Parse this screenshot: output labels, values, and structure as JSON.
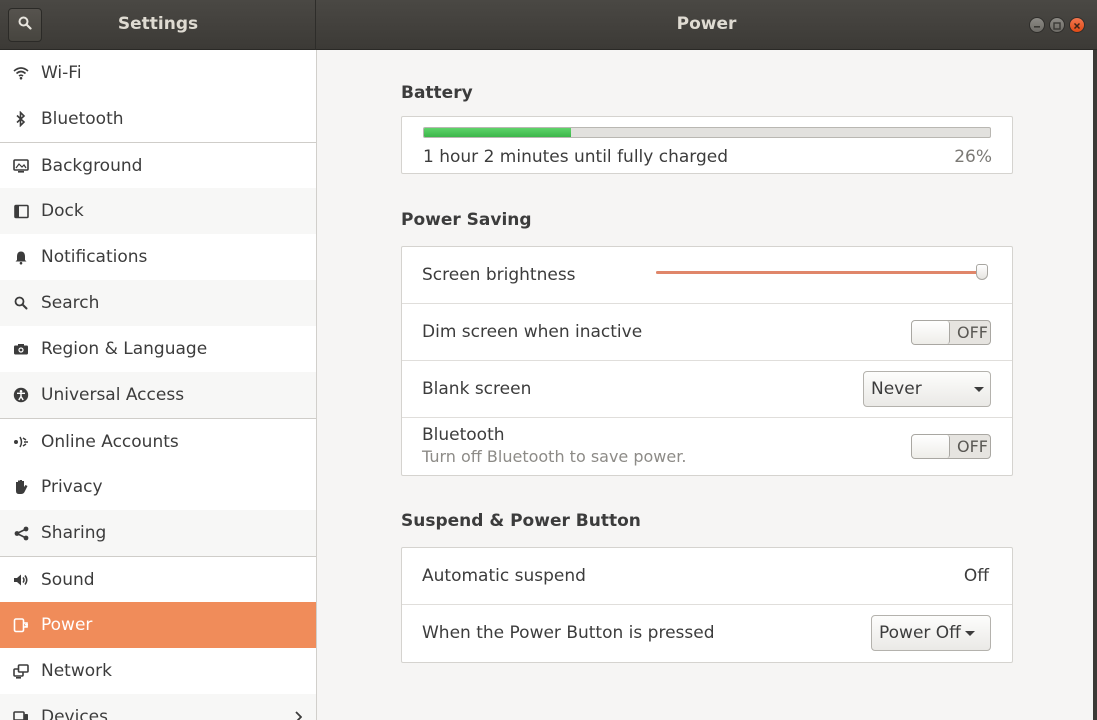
{
  "header": {
    "sidebar_title": "Settings",
    "panel_title": "Power"
  },
  "sidebar": {
    "items": [
      {
        "label": "Wi-Fi",
        "icon": "wifi-icon"
      },
      {
        "label": "Bluetooth",
        "icon": "bluetooth-icon"
      },
      {
        "label": "Background",
        "icon": "background-icon"
      },
      {
        "label": "Dock",
        "icon": "dock-icon"
      },
      {
        "label": "Notifications",
        "icon": "bell-icon"
      },
      {
        "label": "Search",
        "icon": "search-icon"
      },
      {
        "label": "Region & Language",
        "icon": "camera-icon"
      },
      {
        "label": "Universal Access",
        "icon": "accessibility-icon"
      },
      {
        "label": "Online Accounts",
        "icon": "online-accounts-icon"
      },
      {
        "label": "Privacy",
        "icon": "hand-icon"
      },
      {
        "label": "Sharing",
        "icon": "share-icon"
      },
      {
        "label": "Sound",
        "icon": "speaker-icon"
      },
      {
        "label": "Power",
        "icon": "power-icon",
        "active": true
      },
      {
        "label": "Network",
        "icon": "network-icon"
      },
      {
        "label": "Devices",
        "icon": "devices-icon"
      }
    ]
  },
  "battery": {
    "title": "Battery",
    "status": "1 hour 2 minutes until fully charged",
    "percent_label": "26%",
    "level": 0.26
  },
  "power_saving": {
    "title": "Power Saving",
    "screen_brightness": {
      "label": "Screen brightness",
      "value": 1.0
    },
    "dim_screen": {
      "label": "Dim screen when inactive",
      "state": "OFF"
    },
    "blank_screen": {
      "label": "Blank screen",
      "value": "Never"
    },
    "bluetooth": {
      "label": "Bluetooth",
      "sublabel": "Turn off Bluetooth to save power.",
      "state": "OFF"
    }
  },
  "suspend": {
    "title": "Suspend & Power Button",
    "automatic_suspend": {
      "label": "Automatic suspend",
      "value": "Off"
    },
    "power_button": {
      "label": "When the Power Button is pressed",
      "value": "Power Off"
    }
  },
  "colors": {
    "accent": "#f08c5a",
    "battery_fill": "#3cb64a",
    "slider_fill": "#e0866a",
    "close_button": "#df4a16"
  }
}
